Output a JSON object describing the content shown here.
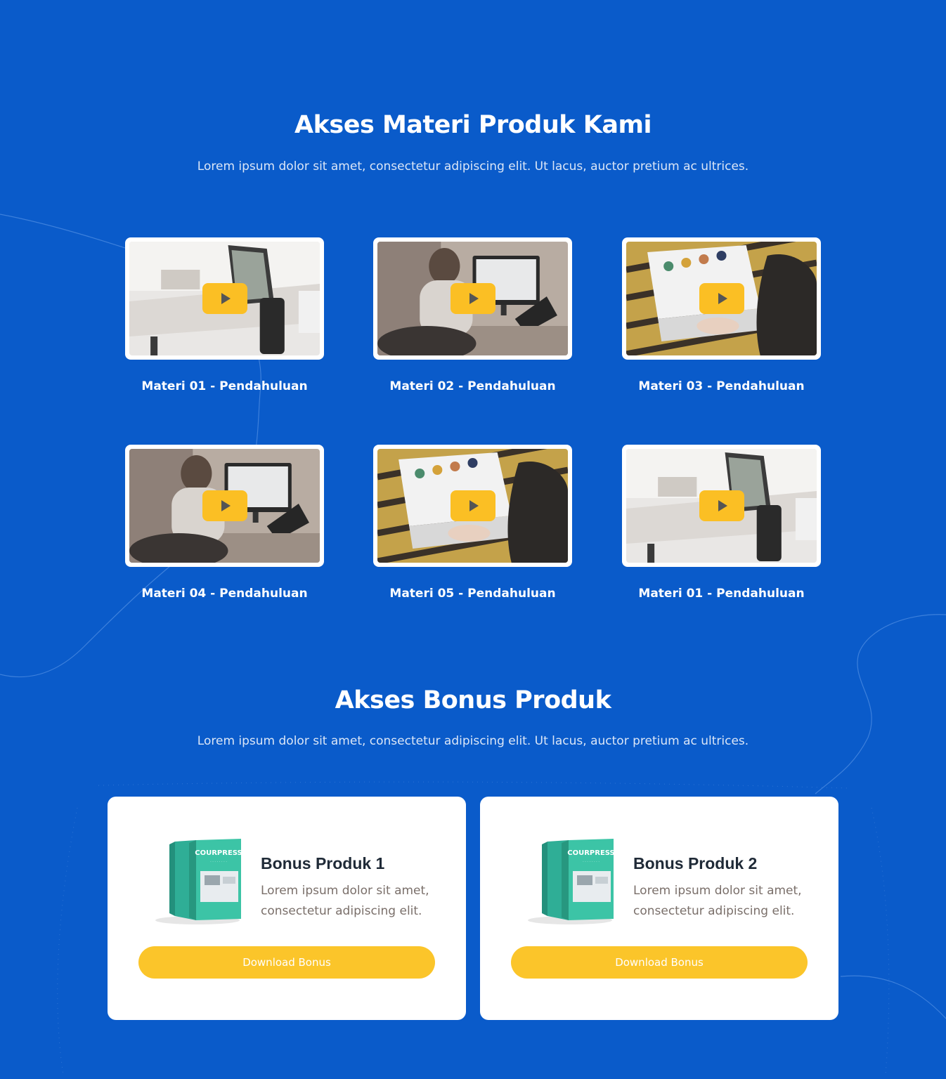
{
  "materi_section": {
    "title": "Akses Materi Produk Kami",
    "subtitle": "Lorem ipsum dolor sit amet, consectetur adipiscing elit. Ut lacus, auctor pretium ac ultrices.",
    "videos": [
      {
        "label": "Materi 01 - Pendahuluan",
        "scene": "desk"
      },
      {
        "label": "Materi 02 - Pendahuluan",
        "scene": "person"
      },
      {
        "label": "Materi 03 - Pendahuluan",
        "scene": "laptop"
      },
      {
        "label": "Materi 04 - Pendahuluan",
        "scene": "person"
      },
      {
        "label": "Materi 05 - Pendahuluan",
        "scene": "laptop"
      },
      {
        "label": "Materi 01 - Pendahuluan",
        "scene": "desk"
      }
    ]
  },
  "bonus_section": {
    "title": "Akses Bonus Produk",
    "subtitle": "Lorem ipsum dolor sit amet, consectetur adipiscing elit. Ut lacus, auctor pretium ac ultrices.",
    "items": [
      {
        "title": "Bonus Produk 1",
        "desc": "Lorem ipsum dolor sit amet, consectetur adipiscing elit.",
        "button": "Download Bonus",
        "box_brand": "COURPRESS"
      },
      {
        "title": "Bonus Produk 2",
        "desc": "Lorem ipsum dolor sit amet, consectetur adipiscing elit.",
        "button": "Download Bonus",
        "box_brand": "COURPRESS"
      }
    ]
  },
  "colors": {
    "background": "#0a5bca",
    "accent": "#fbc52a",
    "card": "#ffffff"
  }
}
